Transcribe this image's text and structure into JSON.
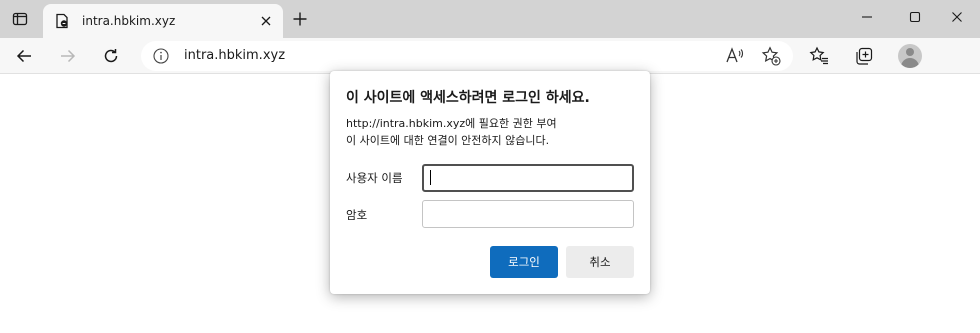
{
  "browser": {
    "tab_title": "intra.hbkim.xyz",
    "address_url": "intra.hbkim.xyz"
  },
  "dialog": {
    "title": "이 사이트에 액세스하려면 로그인 하세요.",
    "message_line1": "http://intra.hbkim.xyz에 필요한 권한 부여",
    "message_line2": "이 사이트에 대한 연결이 안전하지 않습니다.",
    "username_label": "사용자 이름",
    "username_value": "",
    "password_label": "암호",
    "password_value": "",
    "login_button": "로그인",
    "cancel_button": "취소"
  },
  "colors": {
    "accent": "#0f6cbd",
    "titlebar": "#d3d3d3",
    "toolbar": "#f7f7f7"
  },
  "icons": {
    "tab_actions": "tab-actions-icon",
    "favicon": "page-favicon-icon",
    "tab_close": "close-icon",
    "new_tab": "plus-icon",
    "minimize": "minimize-icon",
    "maximize": "maximize-icon",
    "window_close": "close-icon",
    "back": "arrow-left-icon",
    "forward": "arrow-right-icon",
    "refresh": "refresh-icon",
    "info": "info-icon",
    "read_aloud": "read-aloud-icon",
    "add_favorite": "star-plus-icon",
    "favorites": "favorites-icon",
    "collections": "collections-icon",
    "profile": "avatar"
  }
}
